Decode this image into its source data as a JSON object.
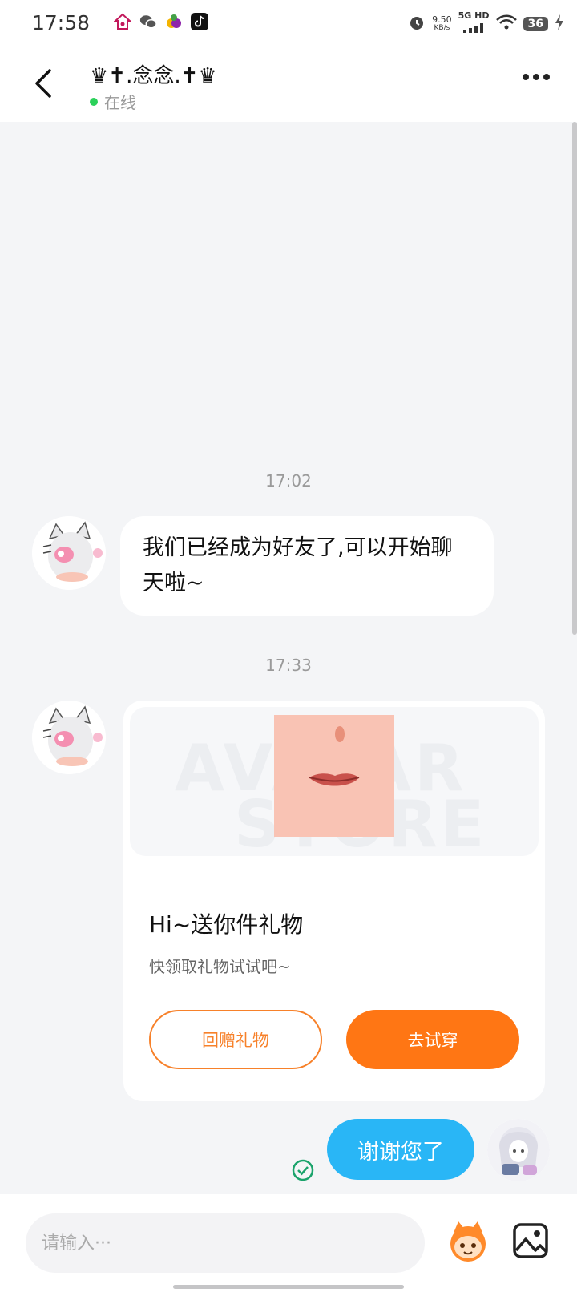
{
  "status_bar": {
    "time": "17:58",
    "net_speed_value": "9.50",
    "net_speed_unit": "KB/s",
    "network": "5G HD",
    "battery": "36"
  },
  "header": {
    "title": "♛✝.念念.✝♛",
    "status": "在线"
  },
  "messages": {
    "timestamp_1": "17:02",
    "friend_notice": "我们已经成为好友了,可以开始聊天啦~",
    "timestamp_2": "17:33",
    "gift_card": {
      "watermark_1": "AVATAR",
      "watermark_2": "STORE",
      "title": "Hi~送你件礼物",
      "subtitle": "快领取礼物试试吧~",
      "return_gift_label": "回赠礼物",
      "try_on_label": "去试穿"
    },
    "outgoing_text": "谢谢您了"
  },
  "input": {
    "placeholder": "请输入···"
  },
  "colors": {
    "accent_orange": "#ff7614",
    "outgoing_bubble": "#29b6f6",
    "online_dot": "#2bd15a",
    "sent_check": "#1aa36b"
  }
}
